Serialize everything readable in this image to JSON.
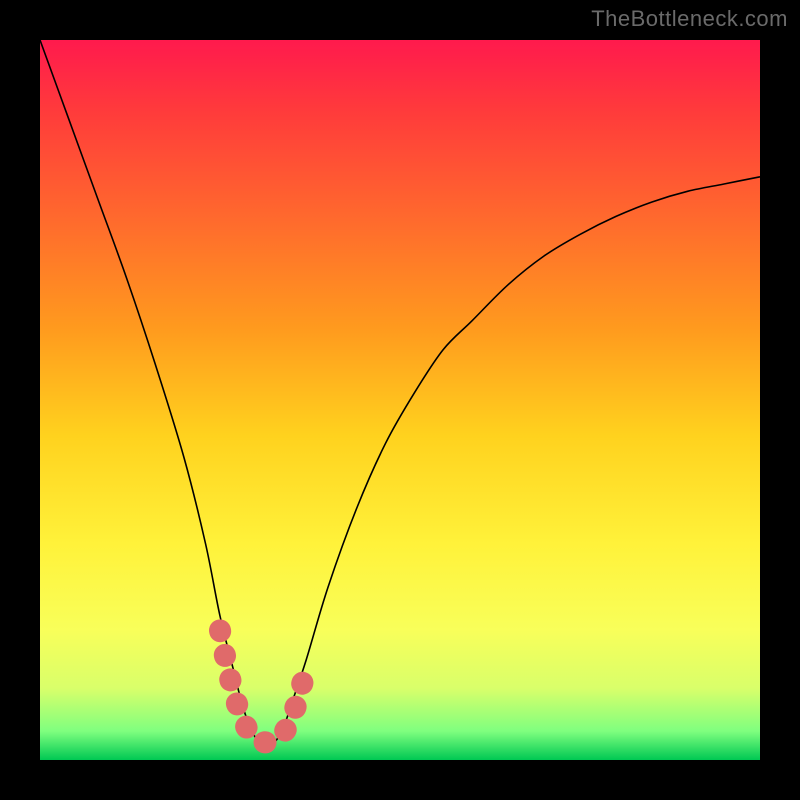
{
  "watermark": "TheBottleneck.com",
  "chart_data": {
    "type": "line",
    "title": "",
    "xlabel": "",
    "ylabel": "",
    "xlim": [
      0,
      100
    ],
    "ylim": [
      0,
      100
    ],
    "grid": false,
    "legend": false,
    "background_gradient": {
      "top": "#ff1a4d",
      "middle": "#fff23a",
      "bottom": "#00c853"
    },
    "series": [
      {
        "name": "bottleneck-curve",
        "style": "thin-black",
        "x": [
          0,
          4,
          8,
          12,
          16,
          20,
          23,
          25,
          27,
          28,
          29,
          30,
          31,
          32,
          33,
          34,
          35,
          37,
          40,
          44,
          48,
          52,
          56,
          60,
          65,
          70,
          75,
          80,
          85,
          90,
          95,
          100
        ],
        "y": [
          100,
          89,
          78,
          67,
          55,
          42,
          30,
          20,
          12,
          8,
          5,
          3,
          2,
          2,
          3,
          5,
          8,
          14,
          24,
          35,
          44,
          51,
          57,
          61,
          66,
          70,
          73,
          75.5,
          77.5,
          79,
          80,
          81
        ]
      },
      {
        "name": "bottleneck-curve-highlight",
        "style": "thick-pink-dotted",
        "x": [
          25,
          26,
          27,
          28,
          29,
          30,
          31,
          32,
          33,
          34,
          35,
          36,
          37
        ],
        "y": [
          18,
          13,
          9,
          6,
          4,
          3,
          2.5,
          2.5,
          3,
          4,
          6,
          9,
          13
        ]
      }
    ]
  }
}
